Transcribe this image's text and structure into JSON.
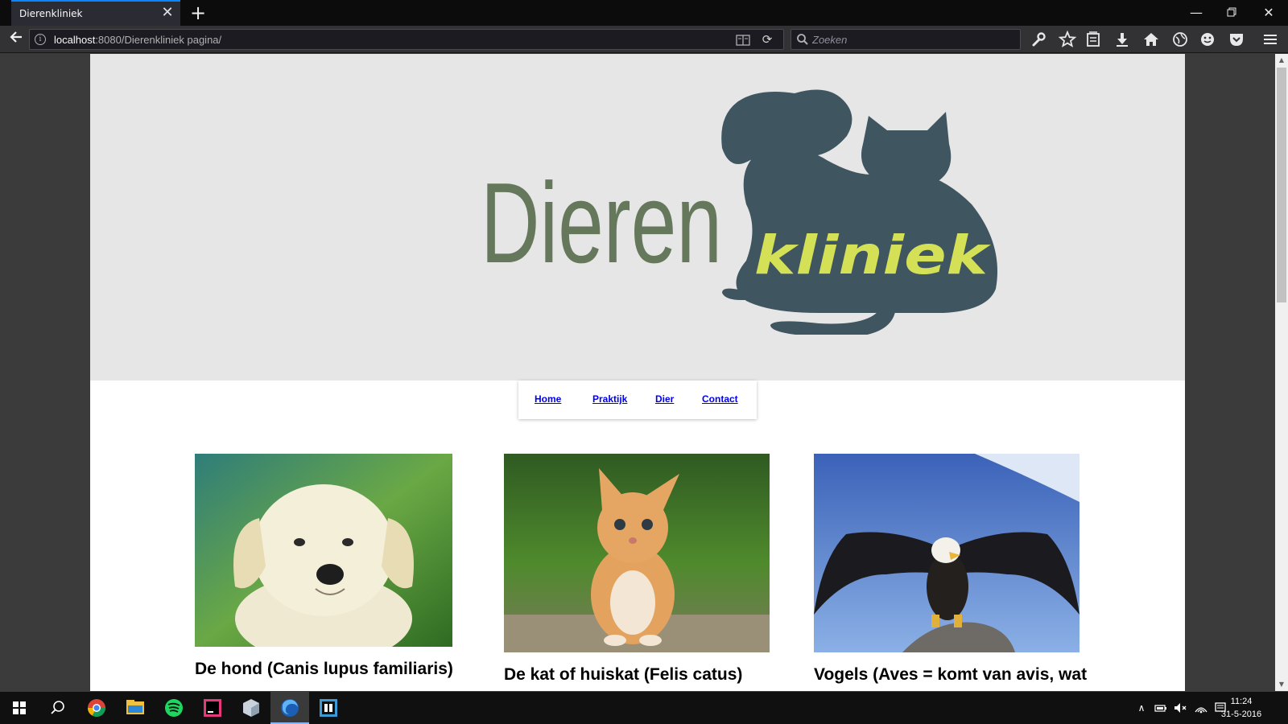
{
  "browser": {
    "tab_title": "Dierenkliniek",
    "tab_close": "✕",
    "new_tab": "+",
    "url_host": "localhost",
    "url_path": ":8080/Dierenkliniek pagina/",
    "search_placeholder": "Zoeken"
  },
  "logo": {
    "word1": "Dieren",
    "word2": "kliniek",
    "text_color": "#66785c",
    "silhouette_color": "#3f5560",
    "accent_color": "#d4e157"
  },
  "nav": {
    "items": [
      "Home",
      "Praktijk",
      "Dier",
      "Contact"
    ]
  },
  "cards": [
    {
      "title": "De hond (Canis lupus familiaris)",
      "image": "white puppy"
    },
    {
      "title": "De kat of huiskat (Felis catus)",
      "image": "orange kitten"
    },
    {
      "title": "Vogels (Aves = komt van avis, wat",
      "image": "bald eagle"
    }
  ],
  "taskbar": {
    "time": "11:24",
    "date": "31-5-2016"
  },
  "icons": {
    "tab_close": "close-icon",
    "new_tab": "plus-icon",
    "back": "back-arrow-icon",
    "info": "info-icon",
    "reader": "reader-view-icon",
    "reload": "reload-icon",
    "search": "search-icon",
    "toolbar": [
      "wrench-icon",
      "star-icon",
      "library-icon",
      "download-icon",
      "home-icon",
      "globe-icon",
      "emoji-icon",
      "pocket-icon",
      "menu-icon"
    ]
  }
}
